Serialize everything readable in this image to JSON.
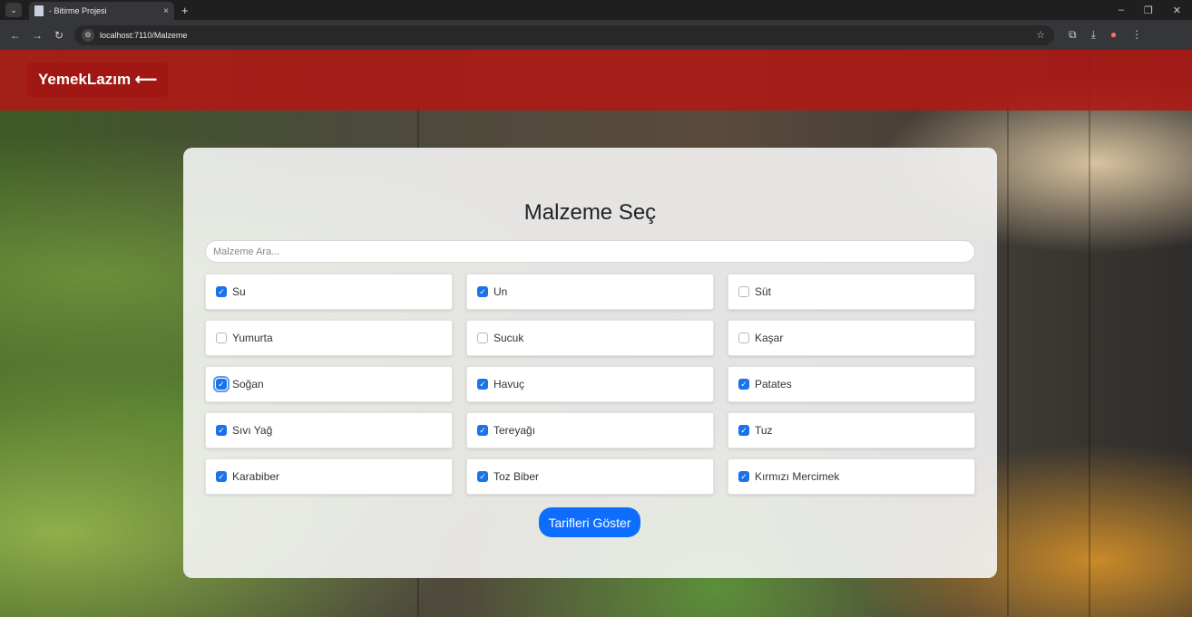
{
  "browser": {
    "tab_title": "- Bitirme Projesi",
    "tab_close": "×",
    "new_tab": "+",
    "url": "localhost:7110/Malzeme",
    "window_controls": [
      "–",
      "❐",
      "✕"
    ]
  },
  "navbar": {
    "brand": "YemekLazım ⟵"
  },
  "form": {
    "title": "Malzeme Seç",
    "search_placeholder": "Malzeme Ara...",
    "submit_label": "Tarifleri Göster",
    "accent_color": "#0d6efd"
  },
  "ingredients": [
    {
      "label": "Su",
      "checked": true
    },
    {
      "label": "Un",
      "checked": true
    },
    {
      "label": "Süt",
      "checked": false
    },
    {
      "label": "Yumurta",
      "checked": false
    },
    {
      "label": "Sucuk",
      "checked": false
    },
    {
      "label": "Kaşar",
      "checked": false
    },
    {
      "label": "Soğan",
      "checked": true
    },
    {
      "label": "Havuç",
      "checked": true
    },
    {
      "label": "Patates",
      "checked": true
    },
    {
      "label": "Sıvı Yağ",
      "checked": true
    },
    {
      "label": "Tereyağı",
      "checked": true
    },
    {
      "label": "Tuz",
      "checked": true
    },
    {
      "label": "Karabiber",
      "checked": true
    },
    {
      "label": "Toz Biber",
      "checked": true
    },
    {
      "label": "Kırmızı Mercimek",
      "checked": true
    }
  ]
}
